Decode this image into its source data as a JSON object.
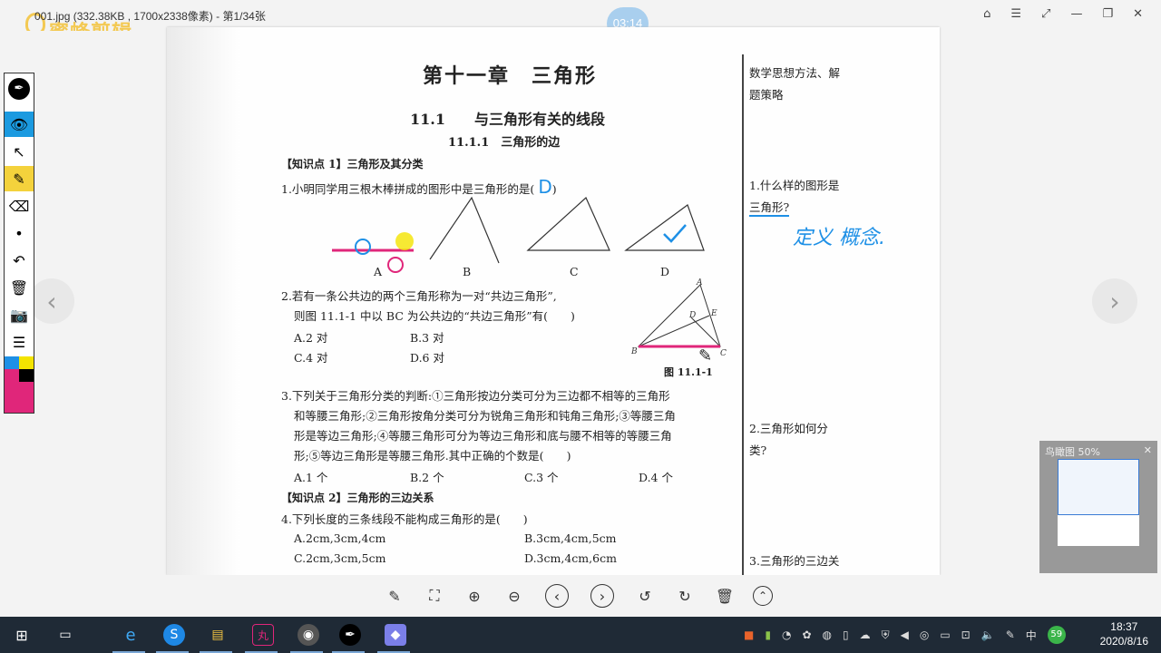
{
  "titlebar": {
    "title": "001.jpg (332.38KB , 1700x2338像素) - 第1/34张",
    "watermark": "蜜蜂剪辑",
    "timer": "03:14"
  },
  "page": {
    "chapter": "第十一章　三角形",
    "section": "11.1　　与三角形有关的线段",
    "subsection": "11.1.1　三角形的边",
    "kp1": "【知识点 1】三角形及其分类",
    "q1": "1.小明同学用三根木棒拼成的图形中是三角形的是(",
    "q1_answer": "D",
    "q1_opts": [
      "A",
      "B",
      "C",
      "D"
    ],
    "q2_line1": "2.若有一条公共边的两个三角形称为一对“共边三角形”,",
    "q2_line2": "则图 11.1-1 中以 BC 为公共边的“共边三角形”有(　　)",
    "q2_opts": [
      "A.2 对",
      "B.3 对",
      "C.4 对",
      "D.6 对"
    ],
    "fig_label": "图 11.1-1",
    "q3_lines": [
      "3.下列关于三角形分类的判断:①三角形按边分类可分为三边都不相等的三角形",
      "和等腰三角形;②三角形按角分类可分为锐角三角形和钝角三角形;③等腰三角",
      "形是等边三角形;④等腰三角形可分为等边三角形和底与腰不相等的等腰三角",
      "形;⑤等边三角形是等腰三角形.其中正确的个数是(　　)"
    ],
    "q3_opts": [
      "A.1 个",
      "B.2 个",
      "C.3 个",
      "D.4 个"
    ],
    "kp2": "【知识点 2】三角形的三边关系",
    "q4": "4.下列长度的三条线段不能构成三角形的是(　　)",
    "q4_opts": [
      "A.2cm,3cm,4cm",
      "B.3cm,4cm,5cm",
      "C.2cm,3cm,5cm",
      "D.3cm,4cm,6cm"
    ],
    "side_heading": [
      "数学思想方法、解",
      "题策略"
    ],
    "side_q1": [
      "1.什么样的图形是",
      "三角形?"
    ],
    "side_handwriting": "定义 概念.",
    "side_q2": [
      "2.三角形如何分",
      "类?"
    ],
    "side_q3": "3.三角形的三边关",
    "fig_points": [
      "A",
      "E",
      "D",
      "B",
      "C"
    ]
  },
  "thumb": {
    "title": "鸟瞰图 50%"
  },
  "taskbar": {
    "time": "18:37",
    "date": "2020/8/16",
    "ime": "中",
    "battery_badge": "59"
  },
  "colors": {
    "ink_blue": "#1e90e6",
    "ink_pink": "#e0267a",
    "ink_yellow": "#f4e400",
    "taskbar": "#1f2a36"
  }
}
